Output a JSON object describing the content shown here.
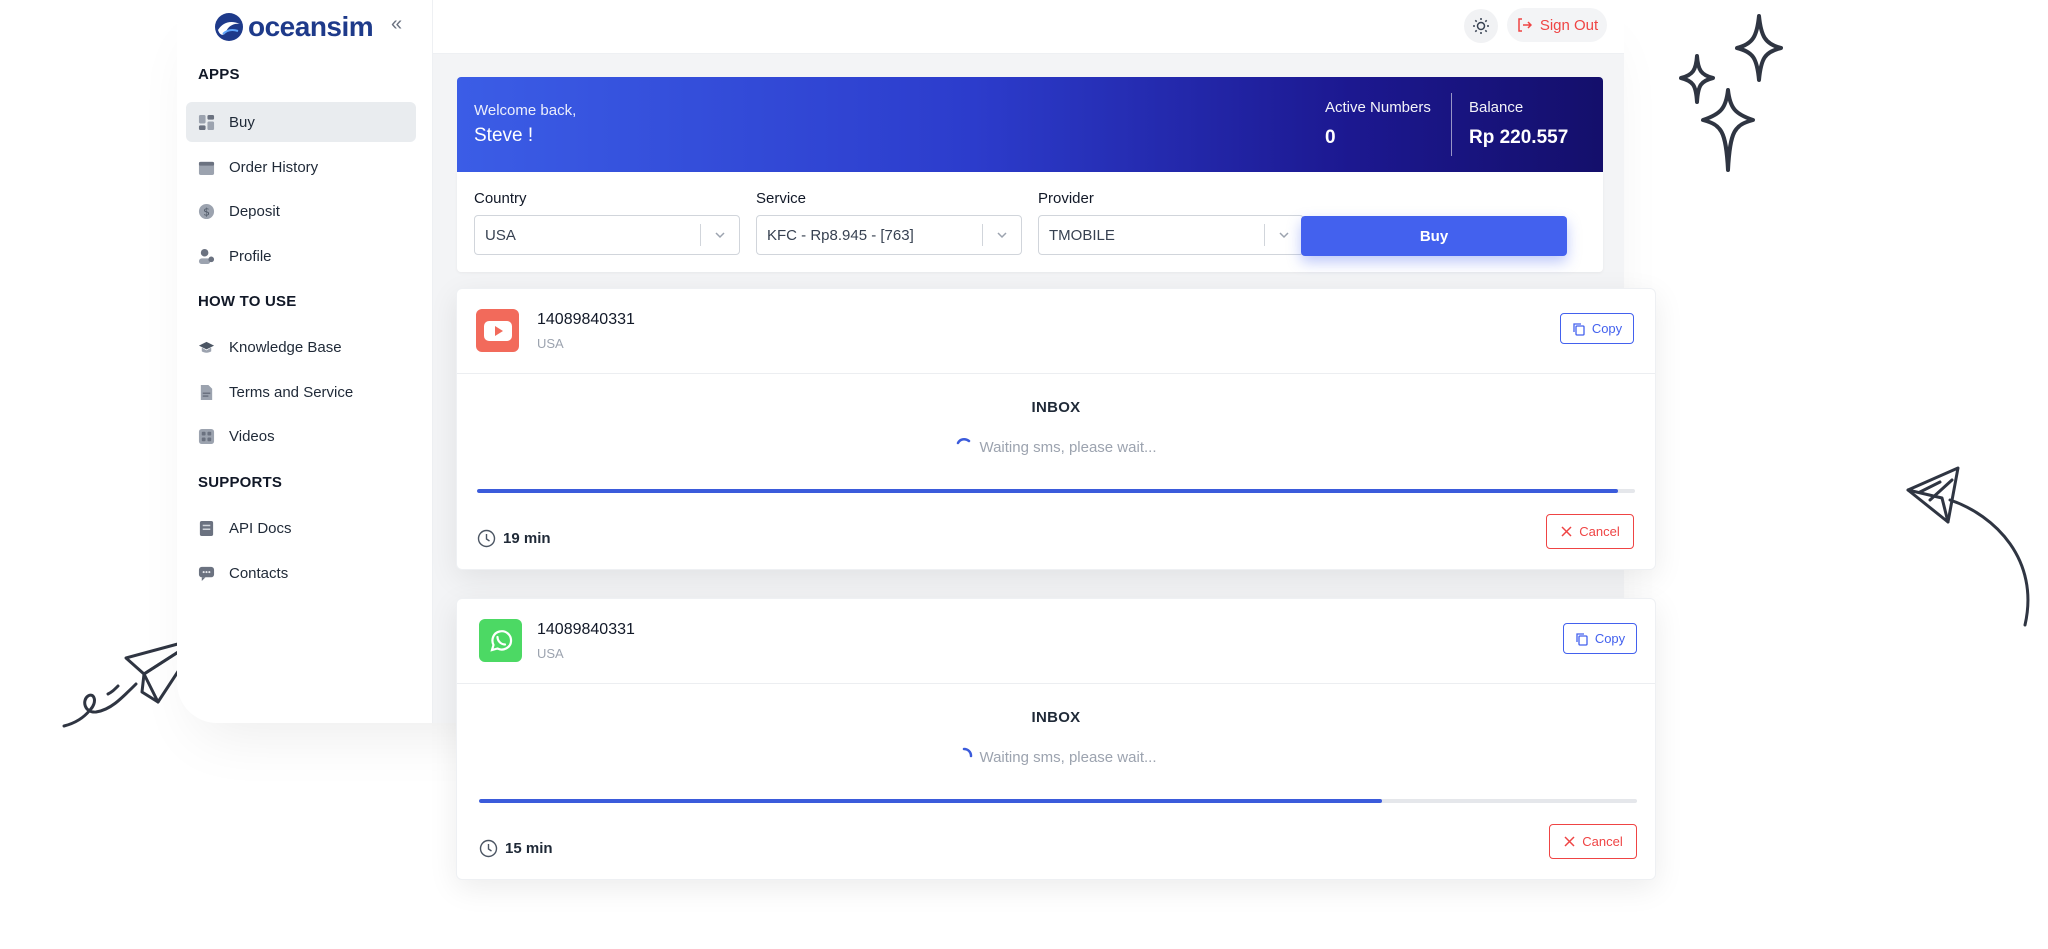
{
  "brand": {
    "name": "oceansim"
  },
  "sidebar": {
    "sections": [
      {
        "title": "APPS",
        "items": [
          {
            "label": "Buy",
            "icon": "dashboard-icon",
            "active": true
          },
          {
            "label": "Order History",
            "icon": "calendar-icon"
          },
          {
            "label": "Deposit",
            "icon": "dollar-icon"
          },
          {
            "label": "Profile",
            "icon": "user-icon"
          }
        ]
      },
      {
        "title": "HOW TO USE",
        "items": [
          {
            "label": "Knowledge Base",
            "icon": "graduation-cap-icon"
          },
          {
            "label": "Terms and Service",
            "icon": "document-icon"
          },
          {
            "label": "Videos",
            "icon": "video-icon"
          }
        ]
      },
      {
        "title": "SUPPORTS",
        "items": [
          {
            "label": "API Docs",
            "icon": "file-icon"
          },
          {
            "label": "Contacts",
            "icon": "chat-icon"
          }
        ]
      }
    ]
  },
  "header": {
    "sign_out": "Sign Out"
  },
  "banner": {
    "welcome": "Welcome back,",
    "user": "Steve !",
    "active_numbers_label": "Active Numbers",
    "active_numbers_value": "0",
    "balance_label": "Balance",
    "balance_value": "Rp 220.557"
  },
  "filters": {
    "country_label": "Country",
    "country_value": "USA",
    "service_label": "Service",
    "service_value": "KFC - Rp8.945 - [763]",
    "provider_label": "Provider",
    "provider_value": "TMOBILE",
    "buy_label": "Buy"
  },
  "orders": [
    {
      "service_icon": "youtube-icon",
      "phone": "14089840331",
      "country": "USA",
      "copy_label": "Copy",
      "inbox_title": "INBOX",
      "waiting_text": "Waiting sms, please wait...",
      "progress": 0.985,
      "time_left": "19 min",
      "cancel_label": "Cancel"
    },
    {
      "service_icon": "whatsapp-icon",
      "phone": "14089840331",
      "country": "USA",
      "copy_label": "Copy",
      "inbox_title": "INBOX",
      "waiting_text": "Waiting sms, please wait...",
      "progress": 0.78,
      "time_left": "15 min",
      "cancel_label": "Cancel"
    }
  ],
  "colors": {
    "accent": "#4361ee",
    "danger": "#ef4444",
    "banner_start": "#3b5de6",
    "banner_end": "#140f6b",
    "youtube": "#f26a5b",
    "whatsapp": "#4cd964"
  }
}
